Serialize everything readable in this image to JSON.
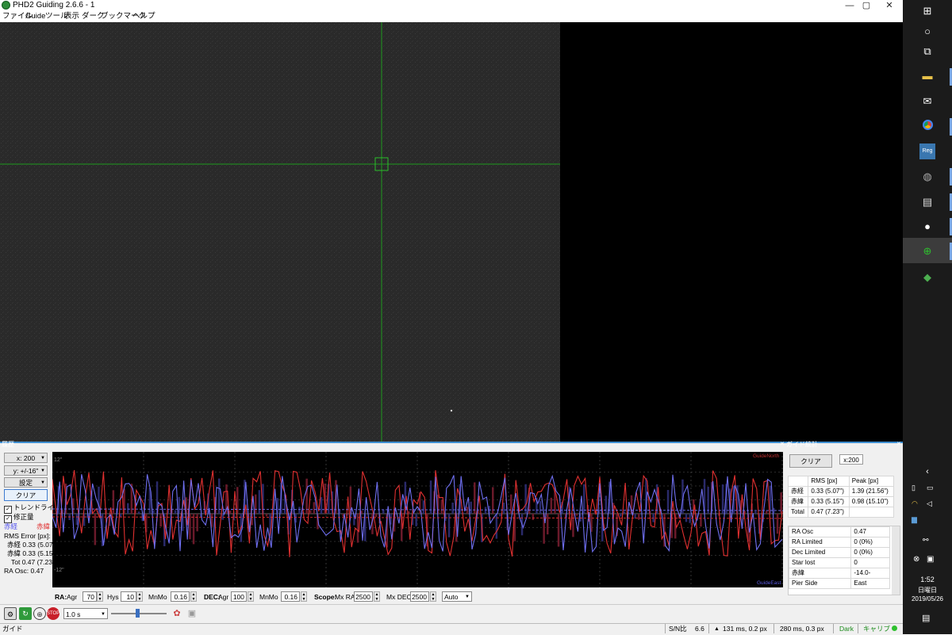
{
  "window": {
    "title": "PHD2 Guiding 2.6.6 - 1",
    "minimize": "—",
    "maximize": "▢",
    "close": "✕"
  },
  "menu": [
    "ファイル",
    "Guide",
    "ツール",
    "表示",
    "ダーク",
    "ブックマーク",
    "ヘルプ"
  ],
  "history": {
    "title": "履歴",
    "x_scale": "x: 200",
    "y_scale": "y: +/-16\"",
    "settings": "設定",
    "clear": "クリア",
    "trendline": "トレンドライン",
    "correction": "修正量",
    "ra_legend": "赤経",
    "dec_legend": "赤緯",
    "rms_title": "RMS Error [px]:",
    "rms_ra": "赤経 0.33 (5.07\")",
    "rms_dec": "赤緯 0.33 (5.15\")",
    "rms_tot": "Tot 0.47 (7.23\")",
    "ra_osc": "RA Osc: 0.47",
    "graph": {
      "y_top": "12\"",
      "y_mid_upper": "4\"",
      "y_mid_lower": "-4\"",
      "y_lower": "-8\"",
      "y_bottom": "-12\"",
      "guide_north": "GuideNorth",
      "guide_east": "GuideEast",
      "ra_color": "#e03030",
      "dec_color": "#6f6ff0"
    },
    "params": {
      "ra_label": "RA:",
      "agr_label": "Agr",
      "ra_agr": "70",
      "hys_label": "Hys",
      "hys": "10",
      "minmo_label": "MnMo",
      "ra_minmo": "0.16",
      "dec_label": "DEC:",
      "dec_agr_label": "Agr",
      "dec_agr": "100",
      "dec_minmo_label": "MnMo",
      "dec_minmo": "0.16",
      "scope_label": "Scope:",
      "mxra_label": "Mx RA",
      "mxra": "2500",
      "mxdec_label": "Mx DEC",
      "mxdec": "2500",
      "mode": "Auto"
    }
  },
  "stats": {
    "title": "ガイド統計",
    "clear": "クリア",
    "scale": "x:200",
    "header": [
      "",
      "RMS [px]",
      "Peak [px]"
    ],
    "rows": [
      [
        "赤経",
        "0.33 (5.07\")",
        "1.39 (21.56\")"
      ],
      [
        "赤緯",
        "0.33 (5.15\")",
        "0.98 (15.10\")"
      ],
      [
        "Total",
        "0.47 (7.23\")",
        ""
      ]
    ],
    "list": [
      [
        "RA Osc",
        "0.47"
      ],
      [
        "RA Limited",
        "0 (0%)"
      ],
      [
        "Dec Limited",
        "0 (0%)"
      ],
      [
        "Star lost",
        "0"
      ],
      [
        "赤緯",
        "-14.0-"
      ],
      [
        "Pier Side",
        "East"
      ]
    ]
  },
  "toolbar": {
    "exposure": "1.0 s",
    "stop": "STOP"
  },
  "status": {
    "mode": "ガイド",
    "sn_label": "S/N比",
    "sn_value": "6.6",
    "ra_corr": "131 ms, 0.2 px",
    "dec_corr": "280 ms, 0.3 px",
    "dark": "Dark",
    "calib": "キャリブ"
  },
  "taskbar": {
    "time": "1:52",
    "day": "日曜日",
    "date": "2019/05/26"
  }
}
